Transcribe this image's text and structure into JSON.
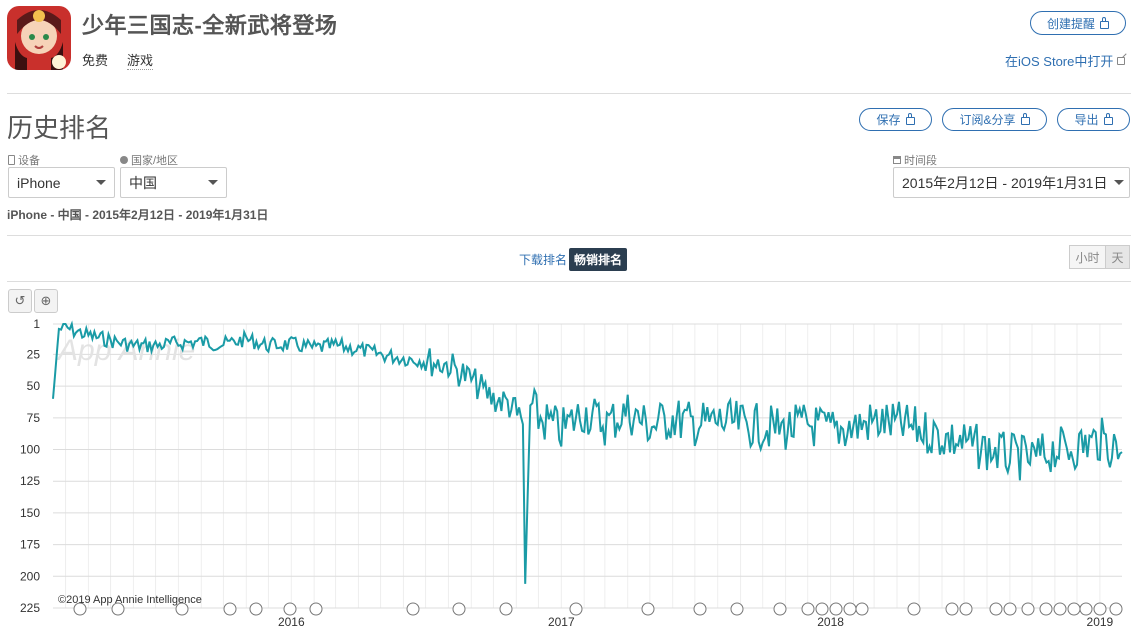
{
  "app": {
    "title": "少年三国志-全新武将登场",
    "price": "免费",
    "category": "游戏",
    "reminder_button": "创建提醒",
    "store_link": "在iOS Store中打开"
  },
  "section": {
    "title": "历史排名",
    "save_button": "保存",
    "subscribe_button": "订阅&分享",
    "export_button": "导出"
  },
  "filters": {
    "device_label": "设备",
    "device_value": "iPhone",
    "country_label": "国家/地区",
    "country_value": "中国",
    "period_label": "时间段",
    "period_value": "2015年2月12日 - 2019年1月31日",
    "summary": "iPhone - 中国 - 2015年2月12日 - 2019年1月31日"
  },
  "chart_tabs": {
    "downloads": "下载排名",
    "grossing": "畅销排名"
  },
  "granularity": {
    "hour": "小时",
    "day": "天"
  },
  "colors": {
    "line": "#1a9ba6",
    "accent": "#2f6fb1",
    "active_tab": "#2b3e50"
  },
  "chart_data": {
    "type": "line",
    "y_axis": "inverted rank",
    "ylim": [
      1,
      225
    ],
    "yticks": [
      "1",
      "25",
      "50",
      "75",
      "100",
      "125",
      "150",
      "175",
      "200",
      "225"
    ],
    "xticks": [
      "2016",
      "2017",
      "2018",
      "2019"
    ],
    "watermark": "App Annie",
    "copyright": "©2019 App Annie Intelligence",
    "series": [
      {
        "x": [
          "2015-02-12",
          "2015-02-20",
          "2015-03-01",
          "2015-04-01",
          "2015-05-01",
          "2015-06-01",
          "2015-07-01",
          "2015-08-01",
          "2015-09-01",
          "2015-10-01",
          "2015-11-01",
          "2015-12-01",
          "2016-01-01",
          "2016-02-01",
          "2016-03-01",
          "2016-04-01",
          "2016-05-01",
          "2016-06-01",
          "2016-07-01",
          "2016-08-01",
          "2016-09-01",
          "2016-10-01",
          "2016-10-20",
          "2016-11-10",
          "2016-11-13",
          "2016-11-20",
          "2016-12-01",
          "2017-01-01",
          "2017-02-01",
          "2017-03-01",
          "2017-04-01",
          "2017-05-01",
          "2017-06-01",
          "2017-07-01",
          "2017-08-01",
          "2017-09-01",
          "2017-10-01",
          "2017-11-01",
          "2017-12-01",
          "2018-01-01",
          "2018-02-01",
          "2018-03-01",
          "2018-04-01",
          "2018-05-01",
          "2018-06-01",
          "2018-07-01",
          "2018-08-01",
          "2018-09-01",
          "2018-10-01",
          "2018-11-01",
          "2018-12-01",
          "2019-01-01",
          "2019-01-31"
        ],
        "y": [
          60,
          5,
          4,
          10,
          14,
          18,
          18,
          16,
          15,
          17,
          13,
          18,
          17,
          20,
          18,
          21,
          25,
          28,
          30,
          33,
          45,
          60,
          63,
          80,
          206,
          65,
          75,
          85,
          70,
          80,
          70,
          82,
          75,
          80,
          78,
          80,
          82,
          84,
          80,
          85,
          82,
          78,
          80,
          84,
          90,
          95,
          100,
          105,
          108,
          100,
          98,
          92,
          102
        ]
      }
    ]
  }
}
